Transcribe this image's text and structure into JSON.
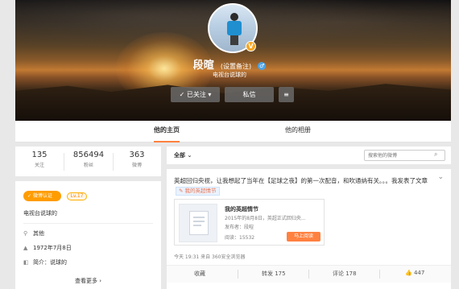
{
  "profile": {
    "name": "段暄",
    "remark": "(设置备注)",
    "bio": "电视台说球的",
    "verified_badge": "V",
    "gender_icon": "male-icon"
  },
  "buttons": {
    "follow": "✓ 已关注 ▾",
    "message": "私信",
    "more_icon": "≡"
  },
  "tabs": [
    {
      "label": "他的主页",
      "active": true
    },
    {
      "label": "他的相册",
      "active": false
    }
  ],
  "stats": [
    {
      "value": "135",
      "label": "关注"
    },
    {
      "value": "856494",
      "label": "粉丝"
    },
    {
      "value": "363",
      "label": "微博"
    }
  ],
  "info": {
    "verify_tag": "微博认证",
    "level": "Lv.17",
    "bio": "电视台说球的",
    "rows": [
      {
        "icon": "location-icon",
        "glyph": "⚲",
        "text": "其他"
      },
      {
        "icon": "birthday-icon",
        "glyph": "▲",
        "text": "1972年7月8日"
      },
      {
        "icon": "intro-icon",
        "glyph": "◧",
        "text": "简介：说球的"
      }
    ],
    "more": "查看更多 ›"
  },
  "feed": {
    "filter": "全部",
    "search_placeholder": "搜索他的微博"
  },
  "post": {
    "text": "英超回归央视，让我想起了当年在【足球之夜】的第一次配音，和吹通纳有关。。。我发表了文章",
    "tag": "✎ 我的英超情节",
    "article": {
      "title": "我的英超情节",
      "subtitle": "2015年的8月8日，英超正式回归央...",
      "author": "发布者：段暄",
      "reads": "阅读：15532",
      "read_button": "马上阅读"
    },
    "meta": "今天 19:31 来自 360安全浏览器",
    "actions": {
      "favorite": "收藏",
      "repost": "转发 175",
      "comment": "评论 178",
      "like": "447"
    }
  },
  "colors": {
    "accent": "#ff8140",
    "verify": "#ff9c00",
    "tag_text": "#eb7350"
  }
}
